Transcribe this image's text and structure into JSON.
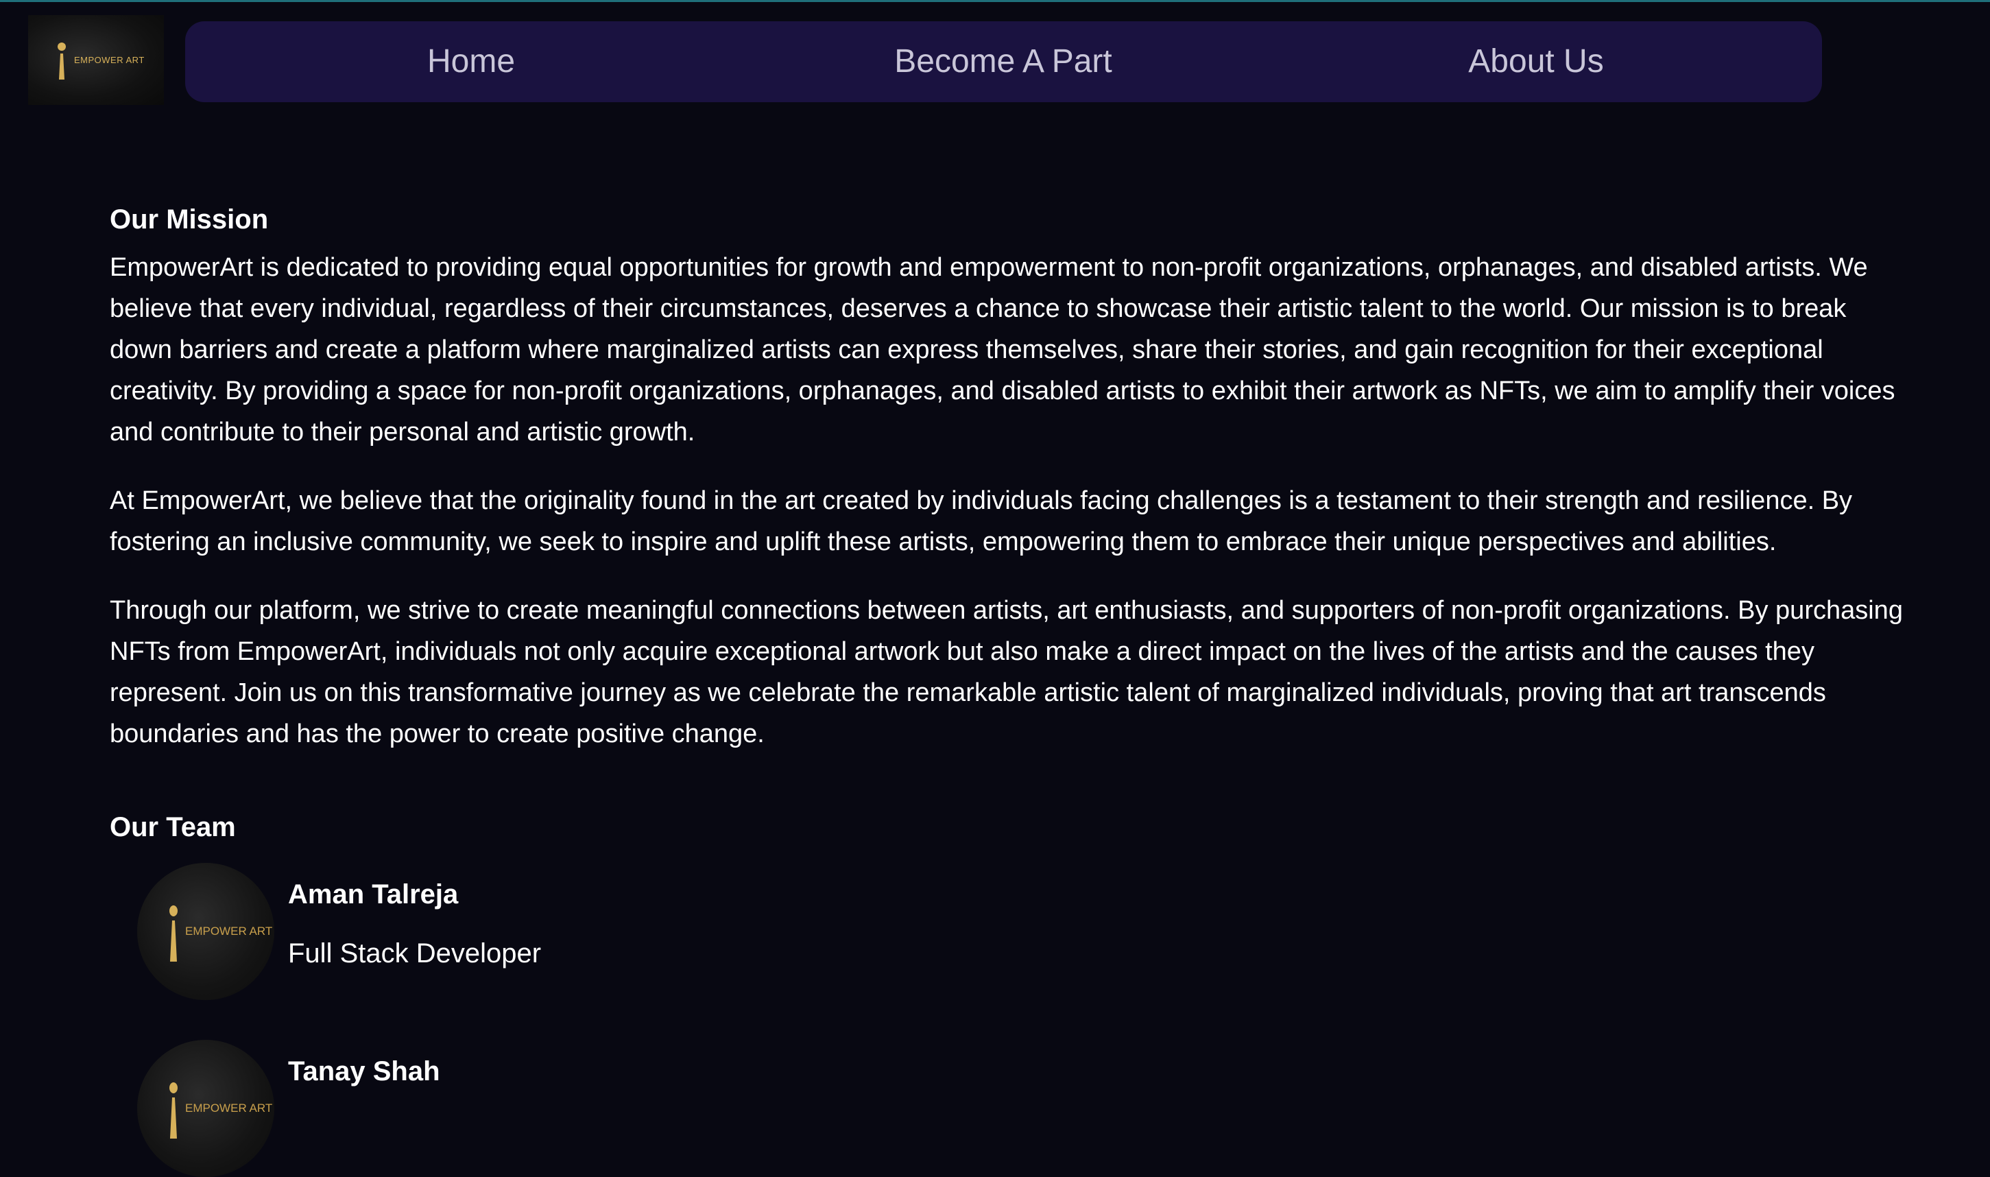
{
  "brand": {
    "logo_text": "EMPOWER ART",
    "gold": "#d7b15a"
  },
  "nav": {
    "items": [
      {
        "label": "Home"
      },
      {
        "label": "Become A Part"
      },
      {
        "label": "About Us"
      }
    ]
  },
  "mission": {
    "title": "Our Mission",
    "paragraphs": [
      "EmpowerArt is dedicated to providing equal opportunities for growth and empowerment to non-profit organizations, orphanages, and disabled artists. We believe that every individual, regardless of their circumstances, deserves a chance to showcase their artistic talent to the world. Our mission is to break down barriers and create a platform where marginalized artists can express themselves, share their stories, and gain recognition for their exceptional creativity. By providing a space for non-profit organizations, orphanages, and disabled artists to exhibit their artwork as NFTs, we aim to amplify their voices and contribute to their personal and artistic growth.",
      "At EmpowerArt, we believe that the originality found in the art created by individuals facing challenges is a testament to their strength and resilience. By fostering an inclusive community, we seek to inspire and uplift these artists, empowering them to embrace their unique perspectives and abilities.",
      "Through our platform, we strive to create meaningful connections between artists, art enthusiasts, and supporters of non-profit organizations. By purchasing NFTs from EmpowerArt, individuals not only acquire exceptional artwork but also make a direct impact on the lives of the artists and the causes they represent. Join us on this transformative journey as we celebrate the remarkable artistic talent of marginalized individuals, proving that art transcends boundaries and has the power to create positive change."
    ]
  },
  "team": {
    "title": "Our Team",
    "members": [
      {
        "name": "Aman Talreja",
        "role": "Full Stack Developer",
        "avatar_text": "EMPOWER ART"
      },
      {
        "name": "Tanay Shah",
        "role": "",
        "avatar_text": "EMPOWER ART"
      }
    ]
  }
}
